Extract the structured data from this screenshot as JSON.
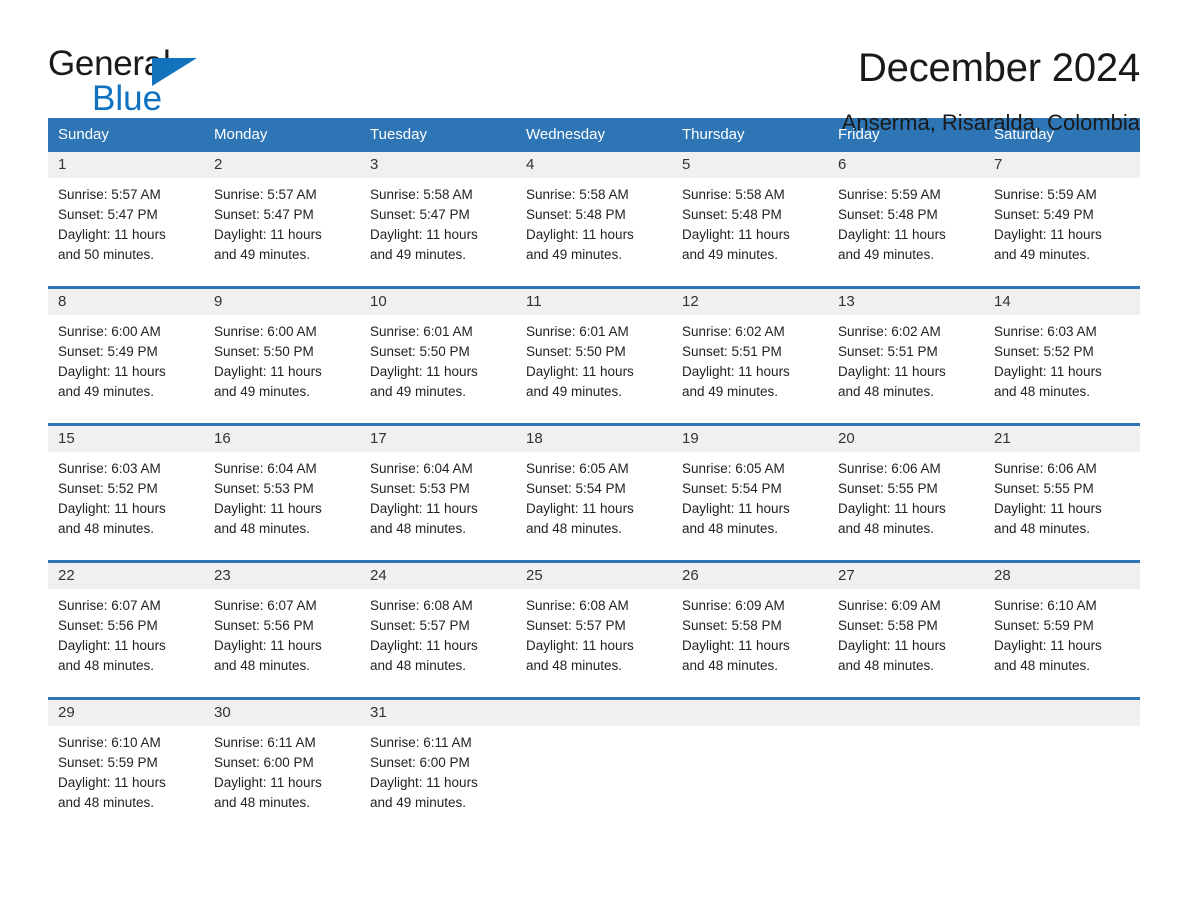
{
  "brand": {
    "name_top": "General",
    "name_bottom": "Blue",
    "accent_color": "#1272BC",
    "text_color": "#1A1A1A"
  },
  "header": {
    "title": "December 2024",
    "subtitle": "Anserma, Risaralda, Colombia"
  },
  "calendar": {
    "header_bg": "#2E75B6",
    "header_text_color": "#FFFFFF",
    "daynum_bg": "#F0F0F0",
    "weekdays": [
      "Sunday",
      "Monday",
      "Tuesday",
      "Wednesday",
      "Thursday",
      "Friday",
      "Saturday"
    ],
    "weeks": [
      [
        {
          "day": "1",
          "sunrise": "Sunrise: 5:57 AM",
          "sunset": "Sunset: 5:47 PM",
          "daylight_1": "Daylight: 11 hours",
          "daylight_2": "and 50 minutes."
        },
        {
          "day": "2",
          "sunrise": "Sunrise: 5:57 AM",
          "sunset": "Sunset: 5:47 PM",
          "daylight_1": "Daylight: 11 hours",
          "daylight_2": "and 49 minutes."
        },
        {
          "day": "3",
          "sunrise": "Sunrise: 5:58 AM",
          "sunset": "Sunset: 5:47 PM",
          "daylight_1": "Daylight: 11 hours",
          "daylight_2": "and 49 minutes."
        },
        {
          "day": "4",
          "sunrise": "Sunrise: 5:58 AM",
          "sunset": "Sunset: 5:48 PM",
          "daylight_1": "Daylight: 11 hours",
          "daylight_2": "and 49 minutes."
        },
        {
          "day": "5",
          "sunrise": "Sunrise: 5:58 AM",
          "sunset": "Sunset: 5:48 PM",
          "daylight_1": "Daylight: 11 hours",
          "daylight_2": "and 49 minutes."
        },
        {
          "day": "6",
          "sunrise": "Sunrise: 5:59 AM",
          "sunset": "Sunset: 5:48 PM",
          "daylight_1": "Daylight: 11 hours",
          "daylight_2": "and 49 minutes."
        },
        {
          "day": "7",
          "sunrise": "Sunrise: 5:59 AM",
          "sunset": "Sunset: 5:49 PM",
          "daylight_1": "Daylight: 11 hours",
          "daylight_2": "and 49 minutes."
        }
      ],
      [
        {
          "day": "8",
          "sunrise": "Sunrise: 6:00 AM",
          "sunset": "Sunset: 5:49 PM",
          "daylight_1": "Daylight: 11 hours",
          "daylight_2": "and 49 minutes."
        },
        {
          "day": "9",
          "sunrise": "Sunrise: 6:00 AM",
          "sunset": "Sunset: 5:50 PM",
          "daylight_1": "Daylight: 11 hours",
          "daylight_2": "and 49 minutes."
        },
        {
          "day": "10",
          "sunrise": "Sunrise: 6:01 AM",
          "sunset": "Sunset: 5:50 PM",
          "daylight_1": "Daylight: 11 hours",
          "daylight_2": "and 49 minutes."
        },
        {
          "day": "11",
          "sunrise": "Sunrise: 6:01 AM",
          "sunset": "Sunset: 5:50 PM",
          "daylight_1": "Daylight: 11 hours",
          "daylight_2": "and 49 minutes."
        },
        {
          "day": "12",
          "sunrise": "Sunrise: 6:02 AM",
          "sunset": "Sunset: 5:51 PM",
          "daylight_1": "Daylight: 11 hours",
          "daylight_2": "and 49 minutes."
        },
        {
          "day": "13",
          "sunrise": "Sunrise: 6:02 AM",
          "sunset": "Sunset: 5:51 PM",
          "daylight_1": "Daylight: 11 hours",
          "daylight_2": "and 48 minutes."
        },
        {
          "day": "14",
          "sunrise": "Sunrise: 6:03 AM",
          "sunset": "Sunset: 5:52 PM",
          "daylight_1": "Daylight: 11 hours",
          "daylight_2": "and 48 minutes."
        }
      ],
      [
        {
          "day": "15",
          "sunrise": "Sunrise: 6:03 AM",
          "sunset": "Sunset: 5:52 PM",
          "daylight_1": "Daylight: 11 hours",
          "daylight_2": "and 48 minutes."
        },
        {
          "day": "16",
          "sunrise": "Sunrise: 6:04 AM",
          "sunset": "Sunset: 5:53 PM",
          "daylight_1": "Daylight: 11 hours",
          "daylight_2": "and 48 minutes."
        },
        {
          "day": "17",
          "sunrise": "Sunrise: 6:04 AM",
          "sunset": "Sunset: 5:53 PM",
          "daylight_1": "Daylight: 11 hours",
          "daylight_2": "and 48 minutes."
        },
        {
          "day": "18",
          "sunrise": "Sunrise: 6:05 AM",
          "sunset": "Sunset: 5:54 PM",
          "daylight_1": "Daylight: 11 hours",
          "daylight_2": "and 48 minutes."
        },
        {
          "day": "19",
          "sunrise": "Sunrise: 6:05 AM",
          "sunset": "Sunset: 5:54 PM",
          "daylight_1": "Daylight: 11 hours",
          "daylight_2": "and 48 minutes."
        },
        {
          "day": "20",
          "sunrise": "Sunrise: 6:06 AM",
          "sunset": "Sunset: 5:55 PM",
          "daylight_1": "Daylight: 11 hours",
          "daylight_2": "and 48 minutes."
        },
        {
          "day": "21",
          "sunrise": "Sunrise: 6:06 AM",
          "sunset": "Sunset: 5:55 PM",
          "daylight_1": "Daylight: 11 hours",
          "daylight_2": "and 48 minutes."
        }
      ],
      [
        {
          "day": "22",
          "sunrise": "Sunrise: 6:07 AM",
          "sunset": "Sunset: 5:56 PM",
          "daylight_1": "Daylight: 11 hours",
          "daylight_2": "and 48 minutes."
        },
        {
          "day": "23",
          "sunrise": "Sunrise: 6:07 AM",
          "sunset": "Sunset: 5:56 PM",
          "daylight_1": "Daylight: 11 hours",
          "daylight_2": "and 48 minutes."
        },
        {
          "day": "24",
          "sunrise": "Sunrise: 6:08 AM",
          "sunset": "Sunset: 5:57 PM",
          "daylight_1": "Daylight: 11 hours",
          "daylight_2": "and 48 minutes."
        },
        {
          "day": "25",
          "sunrise": "Sunrise: 6:08 AM",
          "sunset": "Sunset: 5:57 PM",
          "daylight_1": "Daylight: 11 hours",
          "daylight_2": "and 48 minutes."
        },
        {
          "day": "26",
          "sunrise": "Sunrise: 6:09 AM",
          "sunset": "Sunset: 5:58 PM",
          "daylight_1": "Daylight: 11 hours",
          "daylight_2": "and 48 minutes."
        },
        {
          "day": "27",
          "sunrise": "Sunrise: 6:09 AM",
          "sunset": "Sunset: 5:58 PM",
          "daylight_1": "Daylight: 11 hours",
          "daylight_2": "and 48 minutes."
        },
        {
          "day": "28",
          "sunrise": "Sunrise: 6:10 AM",
          "sunset": "Sunset: 5:59 PM",
          "daylight_1": "Daylight: 11 hours",
          "daylight_2": "and 48 minutes."
        }
      ],
      [
        {
          "day": "29",
          "sunrise": "Sunrise: 6:10 AM",
          "sunset": "Sunset: 5:59 PM",
          "daylight_1": "Daylight: 11 hours",
          "daylight_2": "and 48 minutes."
        },
        {
          "day": "30",
          "sunrise": "Sunrise: 6:11 AM",
          "sunset": "Sunset: 6:00 PM",
          "daylight_1": "Daylight: 11 hours",
          "daylight_2": "and 48 minutes."
        },
        {
          "day": "31",
          "sunrise": "Sunrise: 6:11 AM",
          "sunset": "Sunset: 6:00 PM",
          "daylight_1": "Daylight: 11 hours",
          "daylight_2": "and 49 minutes."
        },
        {
          "day": "",
          "sunrise": "",
          "sunset": "",
          "daylight_1": "",
          "daylight_2": ""
        },
        {
          "day": "",
          "sunrise": "",
          "sunset": "",
          "daylight_1": "",
          "daylight_2": ""
        },
        {
          "day": "",
          "sunrise": "",
          "sunset": "",
          "daylight_1": "",
          "daylight_2": ""
        },
        {
          "day": "",
          "sunrise": "",
          "sunset": "",
          "daylight_1": "",
          "daylight_2": ""
        }
      ]
    ]
  }
}
